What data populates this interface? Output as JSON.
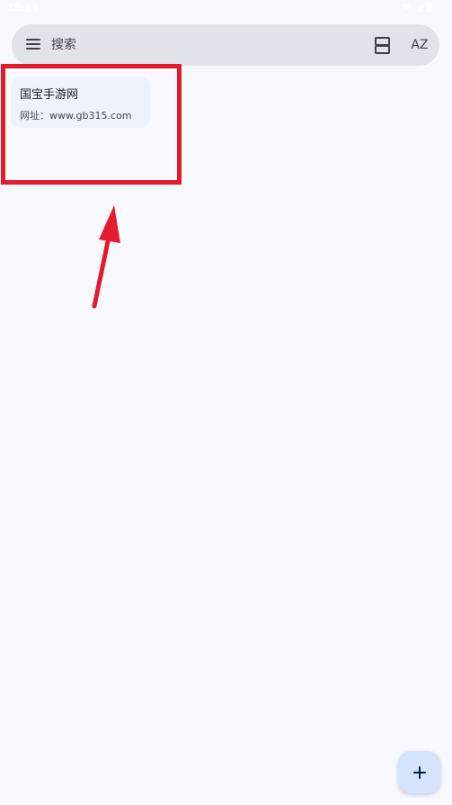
{
  "status_bar": {
    "time": "15:15",
    "icons": [
      "wifi-icon",
      "signal-icon",
      "battery-icon"
    ]
  },
  "search": {
    "placeholder": "搜索",
    "menu_icon": "menu-icon",
    "view_toggle_icon": "view-toggle-icon",
    "sort_icon": "sort-az-icon",
    "sort_label": "AZ"
  },
  "notes": [
    {
      "title": "国宝手游网",
      "body": "网址：www.gb315.com"
    }
  ],
  "annotation": {
    "highlight_color": "#e31b2d"
  },
  "fab": {
    "icon": "plus-icon"
  },
  "colors": {
    "background": "#f8f9ff",
    "search_bar": "#e1e3ea",
    "card": "#eef2fb",
    "fab": "#d6e3ff"
  }
}
